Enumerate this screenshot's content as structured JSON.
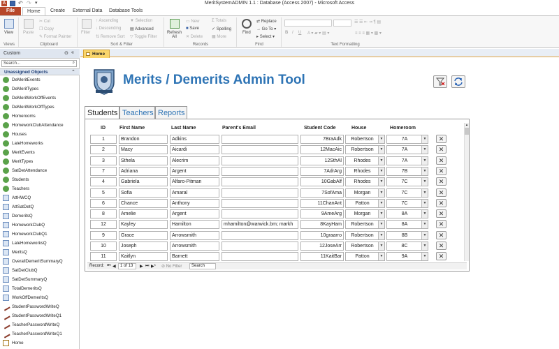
{
  "window": {
    "title": "MeritSystemADMIN 1.1 : Database (Access 2007)  -  Microsoft Access"
  },
  "ribbon_tabs": [
    "File",
    "Home",
    "Create",
    "External Data",
    "Database Tools"
  ],
  "ribbon": {
    "view": "View",
    "clipboard": {
      "paste": "Paste",
      "cut": "Cut",
      "copy": "Copy",
      "format_painter": "Format Painter",
      "label": "Clipboard"
    },
    "views_label": "Views",
    "sort_filter": {
      "filter": "Filter",
      "ascending": "Ascending",
      "descending": "Descending",
      "remove_sort": "Remove Sort",
      "selection": "Selection",
      "advanced": "Advanced",
      "toggle_filter": "Toggle Filter",
      "label": "Sort & Filter"
    },
    "records": {
      "refresh": "Refresh",
      "refresh_all": "All",
      "new": "New",
      "save": "Save",
      "delete": "Delete",
      "totals": "Totals",
      "spelling": "Spelling",
      "more": "More",
      "label": "Records"
    },
    "find": {
      "find": "Find",
      "replace": "Replace",
      "goto": "Go To",
      "select": "Select",
      "label": "Find"
    },
    "text_formatting_label": "Text Formatting"
  },
  "nav": {
    "header": "Custom",
    "search_placeholder": "Search...",
    "category": "Unassigned Objects",
    "items": [
      {
        "label": "DeMeritEvents",
        "kind": "linked-table"
      },
      {
        "label": "DeMeritTypes",
        "kind": "linked-table"
      },
      {
        "label": "DeMeritWorkOffEvents",
        "kind": "linked-table"
      },
      {
        "label": "DeMeritWorkOffTypes",
        "kind": "linked-table"
      },
      {
        "label": "Homerooms",
        "kind": "linked-table"
      },
      {
        "label": "HomeworkClubAttendance",
        "kind": "linked-table"
      },
      {
        "label": "Houses",
        "kind": "linked-table"
      },
      {
        "label": "LateHomeworks",
        "kind": "linked-table"
      },
      {
        "label": "MeritEvents",
        "kind": "linked-table"
      },
      {
        "label": "MeritTypes",
        "kind": "linked-table"
      },
      {
        "label": "SatDetAttendance",
        "kind": "linked-table"
      },
      {
        "label": "Students",
        "kind": "linked-table"
      },
      {
        "label": "Teachers",
        "kind": "linked-table"
      },
      {
        "label": "AttHWCQ",
        "kind": "query"
      },
      {
        "label": "AttSatDetQ",
        "kind": "query"
      },
      {
        "label": "DemeritsQ",
        "kind": "query"
      },
      {
        "label": "HomeworkClubQ",
        "kind": "query"
      },
      {
        "label": "HomeworkClubQ1",
        "kind": "query"
      },
      {
        "label": "LateHomeworksQ",
        "kind": "query"
      },
      {
        "label": "MeritsQ",
        "kind": "query"
      },
      {
        "label": "OverallDemeritSummaryQ",
        "kind": "query"
      },
      {
        "label": "SatDetClubQ",
        "kind": "query"
      },
      {
        "label": "SatDetSummaryQ",
        "kind": "query"
      },
      {
        "label": "TotalDemeritsQ",
        "kind": "query"
      },
      {
        "label": "WorkOffDemeritsQ",
        "kind": "query"
      },
      {
        "label": "StudentPasswordWriteQ",
        "kind": "update-query"
      },
      {
        "label": "StudentPasswordWriteQ1",
        "kind": "update-query"
      },
      {
        "label": "TeacherPasswordWriteQ",
        "kind": "update-query"
      },
      {
        "label": "TeacherPasswordWriteQ1",
        "kind": "update-query"
      },
      {
        "label": "Home",
        "kind": "form"
      }
    ]
  },
  "doc_tab": "Home",
  "form": {
    "title": "Merits / Demerits Admin Tool",
    "tabs": [
      "Students",
      "Teachers",
      "Reports"
    ],
    "columns": {
      "id": "ID",
      "first": "First Name",
      "last": "Last Name",
      "email": "Parent's Email",
      "code": "Student Code",
      "house": "House",
      "homeroom": "Homeroom"
    },
    "rows": [
      {
        "id": "1",
        "first": "Brandon",
        "last": "Adkins",
        "email": "",
        "code": "7BraAdk",
        "house": "Robertson",
        "homeroom": "7A"
      },
      {
        "id": "2",
        "first": "Macy",
        "last": "Aicardi",
        "email": "",
        "code": "12MacAic",
        "house": "Robertson",
        "homeroom": "7A"
      },
      {
        "id": "3",
        "first": "Sthela",
        "last": "Alecrim",
        "email": "",
        "code": "12SthAl",
        "house": "Rhodes",
        "homeroom": "7A"
      },
      {
        "id": "7",
        "first": "Adriana",
        "last": "Argent",
        "email": "",
        "code": "7AdrArg",
        "house": "Rhodes",
        "homeroom": "7B"
      },
      {
        "id": "4",
        "first": "Gabriela",
        "last": "Alfaro-Pitman",
        "email": "",
        "code": "10GabAlf",
        "house": "Rhodes",
        "homeroom": "7C"
      },
      {
        "id": "5",
        "first": "Sofia",
        "last": "Amaral",
        "email": "",
        "code": "7SofAma",
        "house": "Morgan",
        "homeroom": "7C"
      },
      {
        "id": "6",
        "first": "Chance",
        "last": "Anthony",
        "email": "",
        "code": "11ChanAnt",
        "house": "Patton",
        "homeroom": "7C"
      },
      {
        "id": "8",
        "first": "Amelie",
        "last": "Argent",
        "email": "",
        "code": "9AmeArg",
        "house": "Morgan",
        "homeroom": "8A"
      },
      {
        "id": "12",
        "first": "Kayley",
        "last": "Hamilton",
        "email": "mhamilton@warwick.bm; markh",
        "code": "8KayHam",
        "house": "Robertson",
        "homeroom": "8A"
      },
      {
        "id": "9",
        "first": "Grace",
        "last": "Arrowsmith",
        "email": "",
        "code": "10graarro",
        "house": "Robertson",
        "homeroom": "8B"
      },
      {
        "id": "10",
        "first": "Joseph",
        "last": "Arrowsmith",
        "email": "",
        "code": "12JoseArr",
        "house": "Robertson",
        "homeroom": "8C"
      },
      {
        "id": "11",
        "first": "Kaitlyn",
        "last": "Barnett",
        "email": "",
        "code": "11KaitBar",
        "house": "Patton",
        "homeroom": "9A"
      }
    ],
    "record_nav": {
      "label": "Record:",
      "position": "1 of 13",
      "filter": "No Filter",
      "search": "Search"
    }
  }
}
